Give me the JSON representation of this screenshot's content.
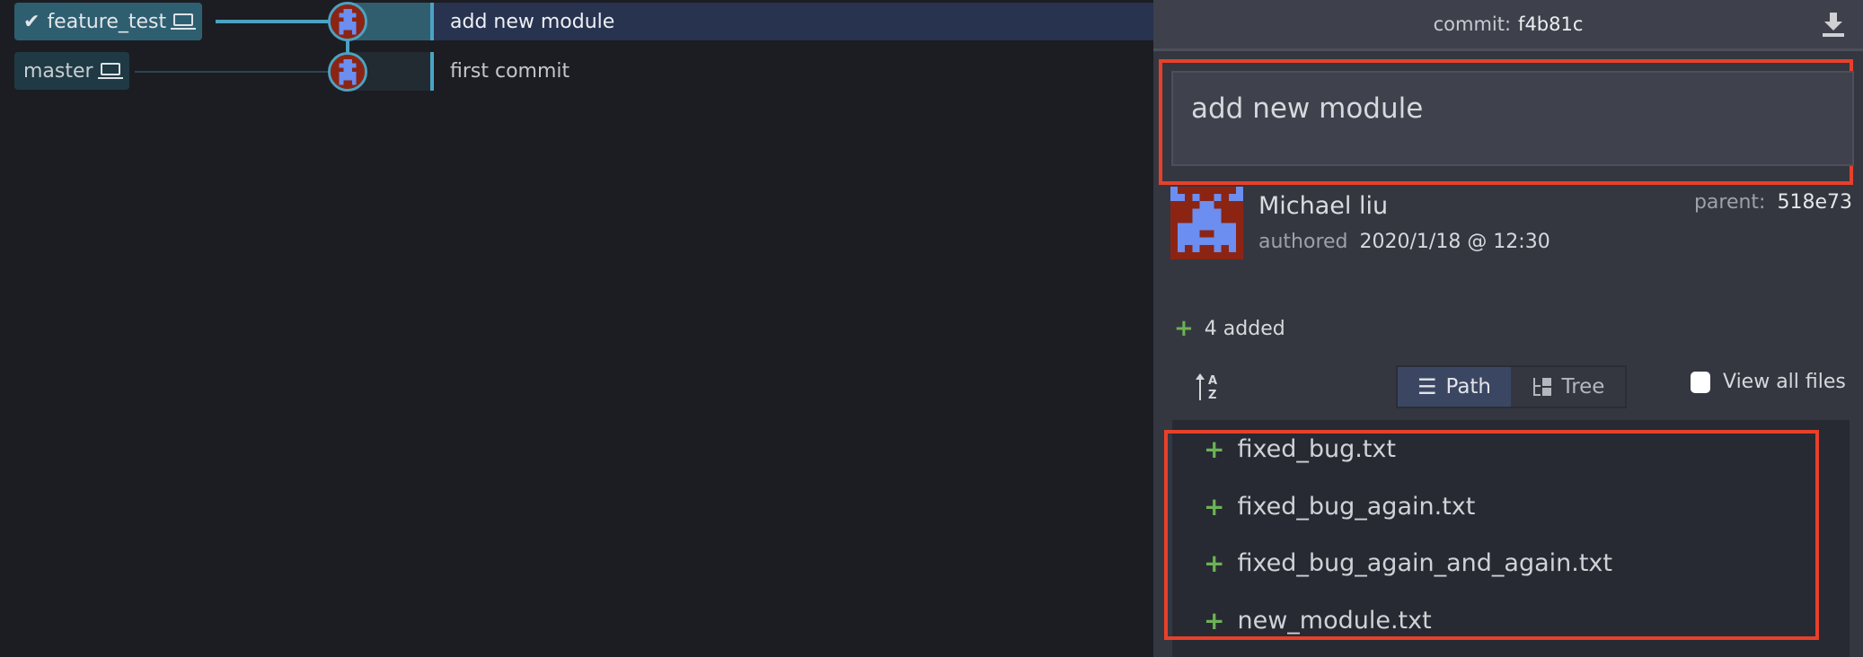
{
  "graph": {
    "rows": [
      {
        "branch": "feature_test",
        "checked": true,
        "message": "add new module",
        "selected": true
      },
      {
        "branch": "master",
        "checked": false,
        "message": "first commit",
        "selected": false
      }
    ]
  },
  "details": {
    "commit_label": "commit:",
    "commit_hash": "f4b81c",
    "message": "add new module",
    "author": "Michael liu",
    "authored_label": "authored",
    "date": "2020/1/18 @ 12:30",
    "parent_label": "parent:",
    "parent_hash": "518e73",
    "summary": "4 added",
    "view_path": "Path",
    "view_tree": "Tree",
    "view_all_files": "View all files",
    "files": [
      "fixed_bug.txt",
      "fixed_bug_again.txt",
      "fixed_bug_again_and_again.txt",
      "new_module.txt"
    ]
  },
  "colors": {
    "accent": "#4aa3c4",
    "added": "#6cb255",
    "highlight": "#e8402a"
  }
}
